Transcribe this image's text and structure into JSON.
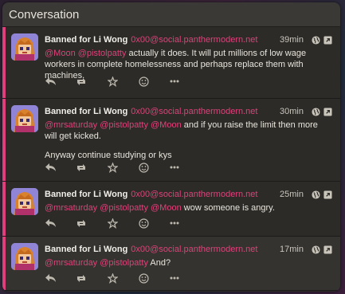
{
  "panel": {
    "title": "Conversation"
  },
  "statuses": [
    {
      "display_name": "Banned for Li Wong",
      "acct": "0x00@social.panthermodern.net",
      "time": "39min",
      "mentions": [
        "@Moon",
        "@pistolpatty"
      ],
      "text": "actually it does. It will put millions of low wage workers in complete homelessness and perhaps replace them with machines.",
      "extra": ""
    },
    {
      "display_name": "Banned for Li Wong",
      "acct": "0x00@social.panthermodern.net",
      "time": "30min",
      "mentions": [
        "@mrsaturday",
        "@pistolpatty",
        "@Moon"
      ],
      "text": "and if you raise the limit then more will get kicked.",
      "extra": "Anyway continue studying or kys"
    },
    {
      "display_name": "Banned for Li Wong",
      "acct": "0x00@social.panthermodern.net",
      "time": "25min",
      "mentions": [
        "@mrsaturday",
        "@pistolpatty",
        "@Moon"
      ],
      "text": "wow someone is angry.",
      "extra": ""
    },
    {
      "display_name": "Banned for Li Wong",
      "acct": "0x00@social.panthermodern.net",
      "time": "17min",
      "mentions": [
        "@mrsaturday",
        "@pistolpatty"
      ],
      "text": "And?",
      "extra": ""
    }
  ],
  "icons": {
    "visibility": "globe-icon",
    "expand": "expand-icon",
    "reply": "reply-icon",
    "repeat": "repeat-icon",
    "favorite": "star-icon",
    "react": "smile-icon",
    "more": "more-icon"
  },
  "colors": {
    "accent": "#e0407a",
    "panel_bg": "#2c2b28",
    "header_bg": "#3a3935",
    "text": "#e8e5dc"
  }
}
